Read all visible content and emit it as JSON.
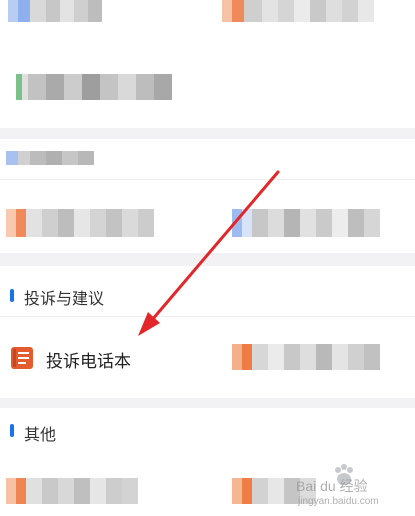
{
  "sections": {
    "complaints": {
      "title": "投诉与建议",
      "items": [
        {
          "label": "投诉电话本",
          "icon": "notebook-icon",
          "icon_color": "#e35b2f"
        },
        {
          "label": "",
          "icon": "blurred-icon"
        }
      ]
    },
    "other": {
      "title": "其他"
    }
  },
  "accent_color": "#1a73e8",
  "arrow_color": "#e3262a",
  "watermark": {
    "brand": "Bai du 经验",
    "url": "jingyan.baidu.com"
  }
}
